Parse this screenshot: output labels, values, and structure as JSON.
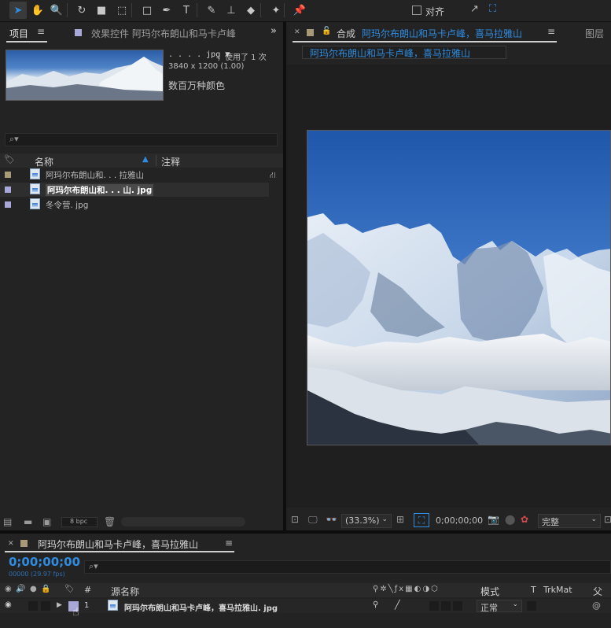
{
  "toolbar": {
    "tools": [
      {
        "icon": "selection-arrow-icon",
        "glyph": "➤",
        "active": true
      },
      {
        "icon": "hand-icon",
        "glyph": "✋"
      },
      {
        "icon": "zoom-icon",
        "glyph": "🔍"
      },
      {
        "icon": "rotate-icon",
        "glyph": "↻"
      },
      {
        "icon": "camera-icon",
        "glyph": "■"
      },
      {
        "icon": "pan-behind-icon",
        "glyph": "⬚"
      },
      {
        "icon": "rectangle-icon",
        "glyph": "□"
      },
      {
        "icon": "pen-icon",
        "glyph": "✒"
      },
      {
        "icon": "type-icon",
        "glyph": "T"
      },
      {
        "icon": "brush-icon",
        "glyph": "✎"
      },
      {
        "icon": "clone-stamp-icon",
        "glyph": "⊥"
      },
      {
        "icon": "eraser-icon",
        "glyph": "◆"
      },
      {
        "icon": "roto-brush-icon",
        "glyph": "✦"
      },
      {
        "icon": "puppet-pin-icon",
        "glyph": "📌"
      }
    ],
    "snap_label": "对齐",
    "accent": "#2f8ce0"
  },
  "project_panel": {
    "tab_label": "项目",
    "effects_tab_label": "效果控件 阿玛尔布朗山和马卡卢峰",
    "preview": {
      "filename": ". . . . jpg ▼",
      "used_label": "，使用了 1 次",
      "dimensions": "3840 x 1200 (1.00)",
      "colors": "数百万种颜色"
    },
    "search_icon": "search-icon",
    "columns": {
      "name": "名称",
      "comment": "注释"
    },
    "items": [
      {
        "name": "阿玛尔布朗山和. . . 拉雅山",
        "tag_color": "#a89a78",
        "type": "composition"
      },
      {
        "name": "阿玛尔布朗山和. . . 山. jpg",
        "tag_color": "#a8a8d8",
        "type": "image",
        "selected": true
      },
      {
        "name": "冬令营. jpg",
        "tag_color": "#a8a8d8",
        "type": "image"
      }
    ],
    "bpc_label": "8 bpc"
  },
  "comp_panel": {
    "tab_prefix": "合成",
    "tab_name": "阿玛尔布朗山和马卡卢峰，喜马拉雅山",
    "right_tab": "图层",
    "breadcrumb": "阿玛尔布朗山和马卡卢峰，喜马拉雅山",
    "zoom": "(33.3%)",
    "timecode": "0;00;00;00",
    "resolution": "完整"
  },
  "timeline": {
    "tab_name": "阿玛尔布朗山和马卡卢峰，喜马拉雅山",
    "timecode": "0;00;00;00",
    "frames": "00000 (29.97 fps)",
    "headers": {
      "number": "#",
      "source_name": "源名称",
      "mode": "模式",
      "t": "T",
      "trkmat": "TrkMat",
      "parent": "父级"
    },
    "layers": [
      {
        "number": "1",
        "name": "阿玛尔布朗山和马卡卢峰，喜马拉雅山. jpg",
        "mode": "正常"
      }
    ]
  }
}
